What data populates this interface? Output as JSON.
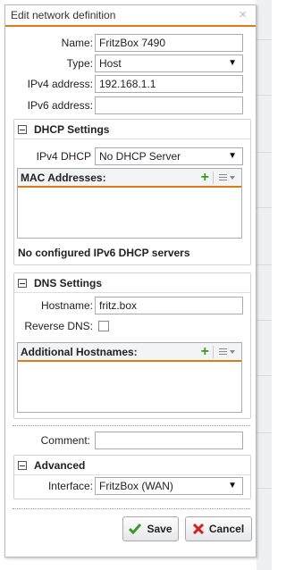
{
  "dialog": {
    "title": "Edit network definition",
    "close_glyph": "×"
  },
  "form": {
    "name_label": "Name:",
    "name_value": "FritzBox 7490",
    "type_label": "Type:",
    "type_value": "Host",
    "ipv4_label": "IPv4 address:",
    "ipv4_value": "192.168.1.1",
    "ipv6_label": "IPv6 address:",
    "ipv6_value": ""
  },
  "dhcp": {
    "title": "DHCP Settings",
    "ipv4_dhcp_label": "IPv4 DHCP",
    "ipv4_dhcp_value": "No DHCP Server",
    "mac_grid_title": "MAC Addresses:",
    "ipv6_status": "No configured IPv6 DHCP servers"
  },
  "dns": {
    "title": "DNS Settings",
    "hostname_label": "Hostname:",
    "hostname_value": "fritz.box",
    "reverse_dns_label": "Reverse DNS:",
    "reverse_dns_checked": false,
    "additional_grid_title": "Additional Hostnames:"
  },
  "comment": {
    "label": "Comment:",
    "value": ""
  },
  "advanced": {
    "title": "Advanced",
    "interface_label": "Interface:",
    "interface_value": "FritzBox (WAN)"
  },
  "buttons": {
    "save": "Save",
    "cancel": "Cancel"
  },
  "icons": {
    "add": "plus-icon",
    "list_menu": "list-menu-icon",
    "save": "checkmark-icon",
    "cancel": "cross-icon",
    "collapse": "collapse-minus-icon"
  },
  "colors": {
    "accent": "#e07a16",
    "add_green": "#3a9b2a",
    "save_green": "#3a9b2a",
    "cancel_red": "#d42020"
  }
}
